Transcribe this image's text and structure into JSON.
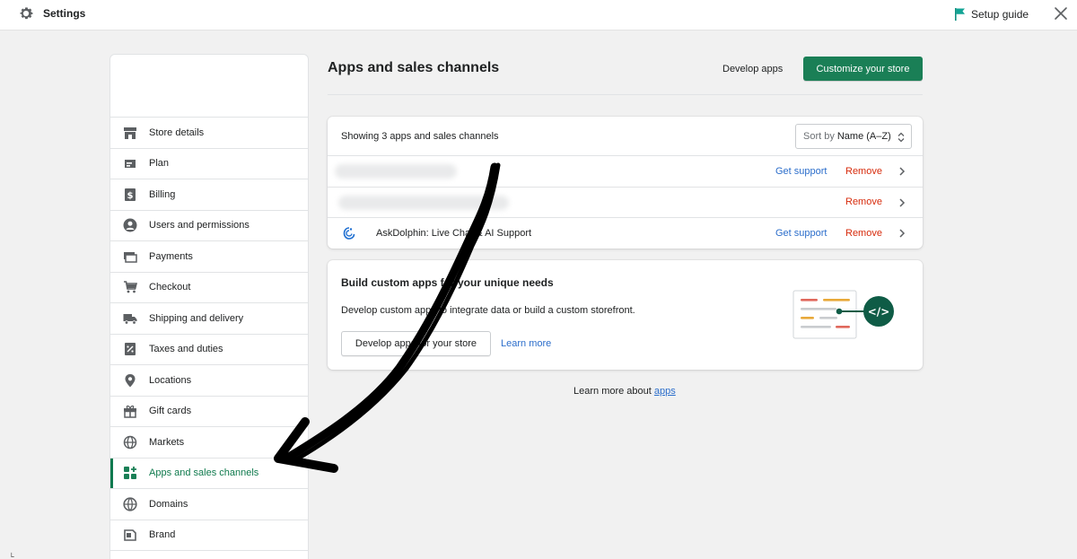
{
  "topbar": {
    "title": "Settings",
    "setup_guide": "Setup guide"
  },
  "sidebar": {
    "items": [
      {
        "label": "Store details",
        "icon": "store-icon"
      },
      {
        "label": "Plan",
        "icon": "plan-icon"
      },
      {
        "label": "Billing",
        "icon": "billing-icon"
      },
      {
        "label": "Users and permissions",
        "icon": "user-icon"
      },
      {
        "label": "Payments",
        "icon": "payments-icon"
      },
      {
        "label": "Checkout",
        "icon": "cart-icon"
      },
      {
        "label": "Shipping and delivery",
        "icon": "truck-icon"
      },
      {
        "label": "Taxes and duties",
        "icon": "tax-icon"
      },
      {
        "label": "Locations",
        "icon": "location-pin-icon"
      },
      {
        "label": "Gift cards",
        "icon": "gift-icon"
      },
      {
        "label": "Markets",
        "icon": "globe-icon"
      },
      {
        "label": "Apps and sales channels",
        "icon": "apps-icon",
        "active": true
      },
      {
        "label": "Domains",
        "icon": "domain-globe-icon"
      },
      {
        "label": "Brand",
        "icon": "brand-icon"
      }
    ]
  },
  "main": {
    "title": "Apps and sales channels",
    "develop_apps": "Develop apps",
    "customize_store": "Customize your store",
    "apps_card": {
      "count_text": "Showing 3 apps and sales channels",
      "sort_prefix": "Sort by",
      "sort_value": "Name (A–Z)",
      "rows": [
        {
          "name": "",
          "support": "Get support",
          "remove": "Remove"
        },
        {
          "name": "",
          "support": "",
          "remove": "Remove"
        },
        {
          "name": "AskDolphin: Live Chat & AI Support",
          "support": "Get support",
          "remove": "Remove"
        }
      ]
    },
    "build_card": {
      "title": "Build custom apps for your unique needs",
      "description": "Develop custom apps to integrate data or build a custom storefront.",
      "button": "Develop apps for your store",
      "learn_more": "Learn more"
    },
    "footer": {
      "prefix": "Learn more about ",
      "link": "apps"
    }
  },
  "colors": {
    "accent": "#1a7f56",
    "link": "#2c6ecb",
    "danger": "#d72c0d",
    "active_text": "#0f7a4d"
  }
}
